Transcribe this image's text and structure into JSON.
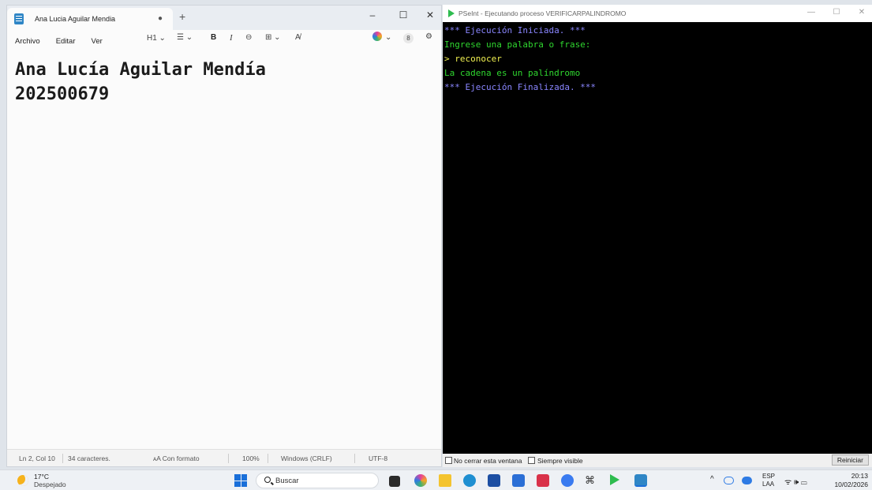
{
  "notepad": {
    "tab_title": "Ana Lucia Aguilar Mendia",
    "tab_unsaved_marker": "●",
    "new_tab": "+",
    "window_controls": {
      "minimize": "–",
      "maximize": "☐",
      "close": "✕"
    },
    "menu": [
      "Archivo",
      "Editar",
      "Ver"
    ],
    "toolbar": {
      "heading": "H1 ⌄",
      "list": "☰ ⌄",
      "bold": "B",
      "italic": "I",
      "link": "⊖",
      "table": "⊞ ⌄",
      "clear_format": "A̸",
      "copilot": "⌄",
      "account": "8",
      "settings": "⚙"
    },
    "document_lines": [
      "Ana Lucía Aguilar Mendía",
      "202500679"
    ],
    "status": {
      "position": "Ln 2, Col 10",
      "characters": "34 caracteres.",
      "format": "ᴀA  Con formato",
      "zoom": "100%",
      "line_endings": "Windows (CRLF)",
      "encoding": "UTF-8"
    }
  },
  "pseint": {
    "title": "PSeInt - Ejecutando proceso VERIFICARPALINDROMO",
    "window_controls": {
      "minimize": "—",
      "maximize": "☐",
      "close": "✕"
    },
    "console_lines": [
      {
        "text": "*** Ejecución Iniciada. ***",
        "color": "#8a86ff"
      },
      {
        "text": "Ingrese una palabra o frase:",
        "color": "#2fd62f"
      },
      {
        "text": "> reconocer",
        "color": "#f0f050"
      },
      {
        "text": "La cadena es un palíndromo",
        "color": "#2fd62f"
      },
      {
        "text": "*** Ejecución Finalizada. ***",
        "color": "#8a86ff"
      }
    ],
    "footer": {
      "no_close_label": "No cerrar esta ventana",
      "always_visible_label": "Siempre visible",
      "restart_button": "Reiniciar"
    }
  },
  "taskbar": {
    "weather_temp": "17°C",
    "weather_condition": "Despejado",
    "search_placeholder": "Buscar",
    "tray": {
      "chevron": "^",
      "language_top": "ESP",
      "language_bottom": "LAA",
      "net_sound_battery": "ᯤ  🕪  ▭",
      "time": "20:13",
      "date": "10/02/2026"
    }
  }
}
